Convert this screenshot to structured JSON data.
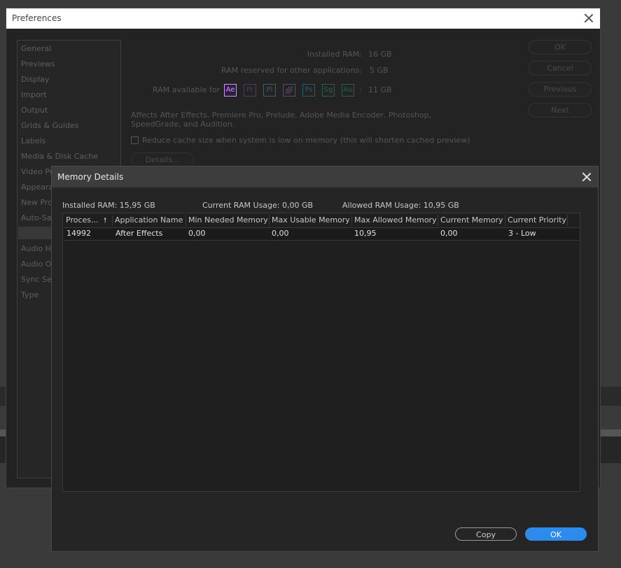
{
  "prefs": {
    "title": "Preferences",
    "sidebar_items": [
      "General",
      "Previews",
      "Display",
      "Import",
      "Output",
      "Grids & Guides",
      "Labels",
      "Media & Disk Cache",
      "Video Pr",
      "Appeara",
      "New Proj",
      "Auto-Sav",
      "",
      "Audio Ha",
      "Audio Ou",
      "Sync Sett",
      "Type"
    ],
    "installed_ram_label": "Installed RAM:",
    "installed_ram_value": "16 GB",
    "reserved_label": "RAM reserved for other applications:",
    "reserved_value": "5 GB",
    "available_label": "RAM available for",
    "available_value": "11 GB",
    "app_icons": [
      {
        "label": "Ae",
        "color": "#d291ff"
      },
      {
        "label": "Pr",
        "color": "#9a53b2"
      },
      {
        "label": "Pl",
        "color": "#5fa6c1"
      },
      {
        "label": "",
        "color": "#9c7ad1"
      },
      {
        "label": "Ps",
        "color": "#3aa0c8"
      },
      {
        "label": "Sg",
        "color": "#3aa87a"
      },
      {
        "label": "Au",
        "color": "#35a87a"
      }
    ],
    "affects_line1": "Affects After Effects, Premiere Pro, Prelude, Adobe Media Encoder, Photoshop,",
    "affects_line2": "SpeedGrade, and Audition.",
    "reduce_cache_label": "Reduce cache size when system is low on memory (this will shorten cached preview)",
    "details_button": "Details...",
    "buttons": {
      "ok": "OK",
      "cancel": "Cancel",
      "previous": "Previous",
      "next": "Next"
    }
  },
  "memory": {
    "title": "Memory Details",
    "installed_ram": "Installed RAM: 15,95 GB",
    "current_usage": "Current RAM Usage: 0,00 GB",
    "allowed_usage": "Allowed RAM Usage: 10,95 GB",
    "columns": [
      "Proces...",
      "Application Name",
      "Min Needed Memory",
      "Max Usable Memory",
      "Max Allowed Memory",
      "Current Memory",
      "Current Priority"
    ],
    "rows": [
      {
        "process": "14992",
        "app": "After Effects",
        "min": "0,00",
        "max_usable": "0,00",
        "max_allowed": "10,95",
        "current": "0,00",
        "priority": "3 - Low"
      }
    ],
    "copy_button": "Copy",
    "ok_button": "OK"
  }
}
